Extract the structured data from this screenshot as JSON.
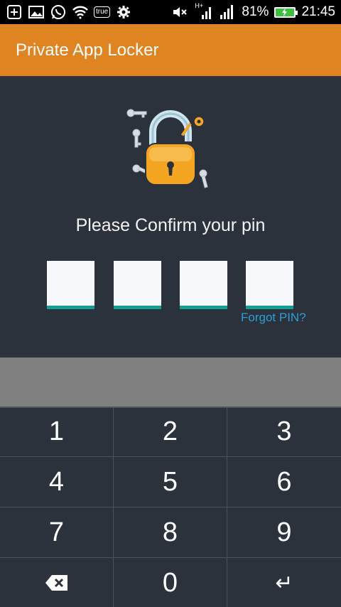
{
  "status_bar": {
    "left_icons": [
      "add-icon",
      "image-icon",
      "whatsapp-icon",
      "wifi-icon",
      "true-badge",
      "settings-icon"
    ],
    "true_label": "true",
    "network_label": "H+",
    "battery_percent": "81%",
    "time": "21:45"
  },
  "app_bar": {
    "title": "Private App Locker"
  },
  "main": {
    "prompt": "Please Confirm your pin",
    "pin_boxes": [
      "",
      "",
      "",
      ""
    ],
    "forgot_label": "Forgot PIN?"
  },
  "keypad": {
    "keys": [
      "1",
      "2",
      "3",
      "4",
      "5",
      "6",
      "7",
      "8",
      "9",
      "backspace",
      "0",
      "enter"
    ],
    "zero": "0",
    "enter_glyph": "↵"
  },
  "colors": {
    "accent_orange": "#e08421",
    "background": "#2c323b",
    "pin_underline": "#149d95",
    "link_blue": "#2a9fd6"
  }
}
